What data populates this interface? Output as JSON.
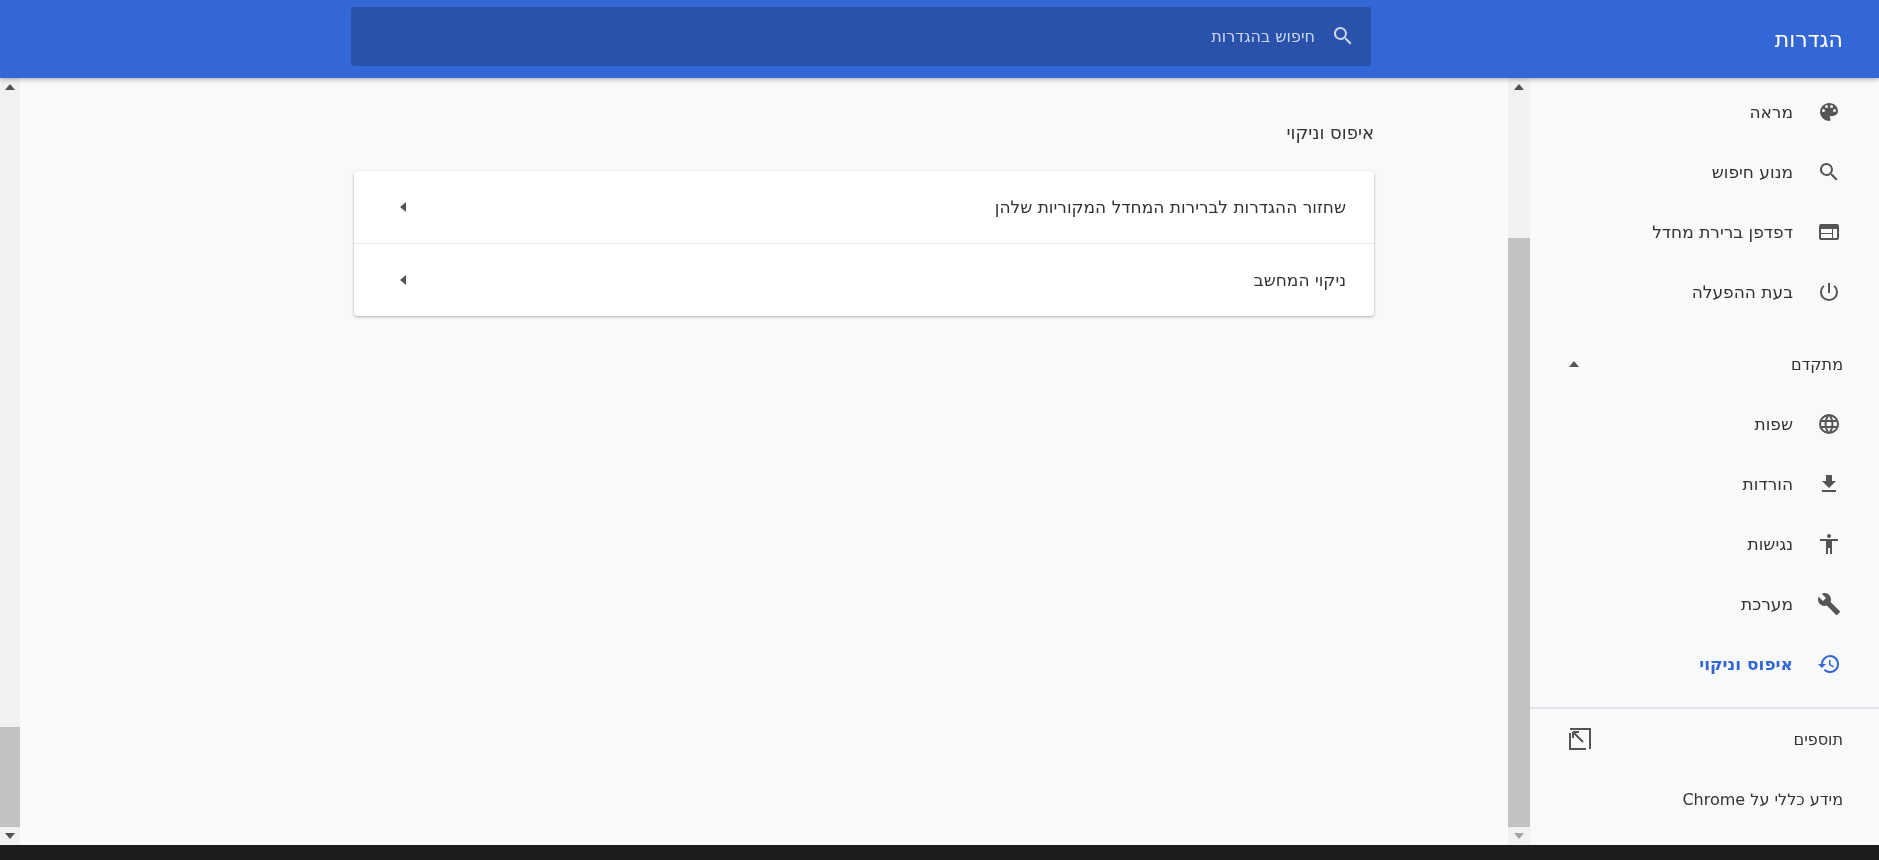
{
  "header": {
    "title": "הגדרות",
    "search": {
      "placeholder": "חיפוש בהגדרות"
    }
  },
  "sidebar": {
    "items": [
      {
        "label": "מראה",
        "selected": false
      },
      {
        "label": "מנוע חיפוש",
        "selected": false
      },
      {
        "label": "דפדפן ברירת מחדל",
        "selected": false
      },
      {
        "label": "בעת ההפעלה",
        "selected": false
      }
    ],
    "advanced": {
      "label": "מתקדם",
      "expanded": true
    },
    "advanced_items": [
      {
        "label": "שפות",
        "selected": false
      },
      {
        "label": "הורדות",
        "selected": false
      },
      {
        "label": "נגישות",
        "selected": false
      },
      {
        "label": "מערכת",
        "selected": false
      },
      {
        "label": "איפוס וניקוי",
        "selected": true
      }
    ],
    "links": [
      {
        "label": "תוספים",
        "kind": "external"
      },
      {
        "label": "מידע כללי על Chrome",
        "kind": "plain"
      }
    ]
  },
  "section": {
    "title": "איפוס וניקוי",
    "rows": [
      {
        "label": "שחזור ההגדרות לברירות המחדל המקוריות שלהן"
      },
      {
        "label": "ניקוי המחשב"
      }
    ]
  }
}
